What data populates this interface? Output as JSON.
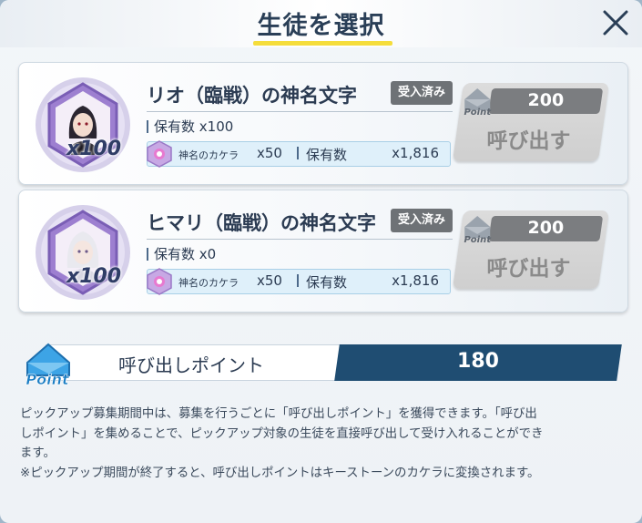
{
  "header": {
    "title": "生徒を選択",
    "close_icon": "close-icon"
  },
  "cards": [
    {
      "name": "リオ（臨戦）の神名文字",
      "badge": "受入済み",
      "quantity": "x100",
      "owned_label": "保有数",
      "owned_value": "x100",
      "camera_label": "神名のカケラ",
      "camera_qty": "x50",
      "camera_owned_label": "保有数",
      "camera_owned_value": "x1,816",
      "button": {
        "point_icon_text": "Point",
        "cost": "200",
        "label": "呼び出す"
      }
    },
    {
      "name": "ヒマリ（臨戦）の神名文字",
      "badge": "受入済み",
      "quantity": "x100",
      "owned_label": "保有数",
      "owned_value": "x0",
      "camera_label": "神名のカケラ",
      "camera_qty": "x50",
      "camera_owned_label": "保有数",
      "camera_owned_value": "x1,816",
      "button": {
        "point_icon_text": "Point",
        "cost": "200",
        "label": "呼び出す"
      }
    }
  ],
  "points": {
    "icon_text": "Point",
    "label": "呼び出しポイント",
    "value": "180"
  },
  "description": {
    "line1": "ピックアップ募集期間中は、募集を行うごとに「呼び出しポイント」を獲得できます。「呼び出",
    "line2": "しポイント」を集めることで、ピックアップ対象の生徒を直接呼び出して受け入れることができ",
    "line3": "ます。",
    "line4": "※ピックアップ期間が終了すると、呼び出しポイントはキーストーンのカケラに変換されます。"
  },
  "colors": {
    "accent_yellow": "#f5dd3b",
    "navy": "#1f4d72",
    "disabled_gray": "#cfcfcf"
  }
}
